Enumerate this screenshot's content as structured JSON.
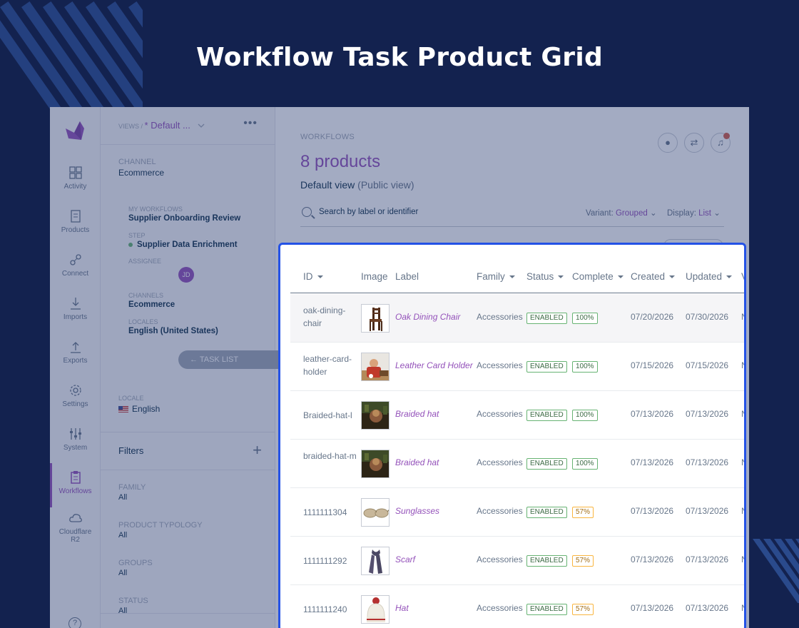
{
  "page": {
    "title": "Workflow Task Product Grid"
  },
  "colors": {
    "accent": "#9452ba",
    "highlight": "#2452e6",
    "success": "#67b373",
    "warning": "#f9b53f",
    "background": "#13224f"
  },
  "nav": {
    "items": [
      {
        "label": "Activity",
        "icon": "activity-icon"
      },
      {
        "label": "Products",
        "icon": "products-icon"
      },
      {
        "label": "Connect",
        "icon": "connect-icon"
      },
      {
        "label": "Imports",
        "icon": "imports-icon"
      },
      {
        "label": "Exports",
        "icon": "exports-icon"
      },
      {
        "label": "Settings",
        "icon": "settings-icon"
      },
      {
        "label": "System",
        "icon": "system-icon"
      },
      {
        "label": "Workflows",
        "icon": "workflows-icon",
        "active": true
      },
      {
        "label": "Cloudflare R2",
        "icon": "cloud-icon"
      }
    ],
    "help": "?"
  },
  "sidebar": {
    "views_prefix": "VIEWS /",
    "view_name": "* Default ...",
    "more": "•••",
    "channel_label": "CHANNEL",
    "channel_value": "Ecommerce",
    "my_workflows_label": "MY WORKFLOWS",
    "my_workflows_value": "Supplier Onboarding Review",
    "step_label": "STEP",
    "step_value": "Supplier Data Enrichment",
    "assignee_label": "ASSIGNEE",
    "assignee_initials": "JD",
    "channels_label": "CHANNELS",
    "channels_value": "Ecommerce",
    "locales_label": "LOCALES",
    "locales_value": "English (United States)",
    "task_list_button": "← TASK LIST",
    "locale_label": "LOCALE",
    "locale_value": "English",
    "filters_title": "Filters",
    "filters": [
      {
        "label": "FAMILY",
        "value": "All"
      },
      {
        "label": "PRODUCT TYPOLOGY",
        "value": "All"
      },
      {
        "label": "GROUPS",
        "value": "All"
      },
      {
        "label": "STATUS",
        "value": "All"
      }
    ]
  },
  "main": {
    "breadcrumb": "WORKFLOWS",
    "count": "8 products",
    "view_name": "Default view",
    "view_scope": "(Public view)",
    "search_placeholder": "Search by label or identifier",
    "variant_label": "Variant:",
    "variant_value": "Grouped",
    "display_label": "Display:",
    "display_value": "List"
  },
  "grid": {
    "columns": [
      "ID",
      "Image",
      "Label",
      "Family",
      "Status",
      "Complete",
      "Created",
      "Updated",
      "V"
    ],
    "rows": [
      {
        "id": "oak-dining-chair",
        "label": "Oak Dining Chair",
        "family": "Accessories",
        "status": "ENABLED",
        "complete": "100%",
        "created": "07/20/2026",
        "updated": "07/30/2026",
        "extra": "N",
        "image": "chair"
      },
      {
        "id": "leather-card-holder",
        "label": "Leather Card Holder",
        "family": "Accessories",
        "status": "ENABLED",
        "complete": "100%",
        "created": "07/15/2026",
        "updated": "07/15/2026",
        "extra": "N",
        "image": "person"
      },
      {
        "id": "Braided-hat-l",
        "label": "Braided hat",
        "family": "Accessories",
        "status": "ENABLED",
        "complete": "100%",
        "created": "07/13/2026",
        "updated": "07/13/2026",
        "extra": "N",
        "image": "forest"
      },
      {
        "id": "braided-hat-m",
        "label": "Braided hat",
        "family": "Accessories",
        "status": "ENABLED",
        "complete": "100%",
        "created": "07/13/2026",
        "updated": "07/13/2026",
        "extra": "N",
        "image": "forest"
      },
      {
        "id": "1111111304",
        "label": "Sunglasses",
        "family": "Accessories",
        "status": "ENABLED",
        "complete": "57%",
        "created": "07/13/2026",
        "updated": "07/13/2026",
        "extra": "N",
        "image": "sunglasses"
      },
      {
        "id": "1111111292",
        "label": "Scarf",
        "family": "Accessories",
        "status": "ENABLED",
        "complete": "57%",
        "created": "07/13/2026",
        "updated": "07/13/2026",
        "extra": "N",
        "image": "scarf"
      },
      {
        "id": "1111111240",
        "label": "Hat",
        "family": "Accessories",
        "status": "ENABLED",
        "complete": "57%",
        "created": "07/13/2026",
        "updated": "07/13/2026",
        "extra": "N",
        "image": "beanie"
      }
    ]
  }
}
